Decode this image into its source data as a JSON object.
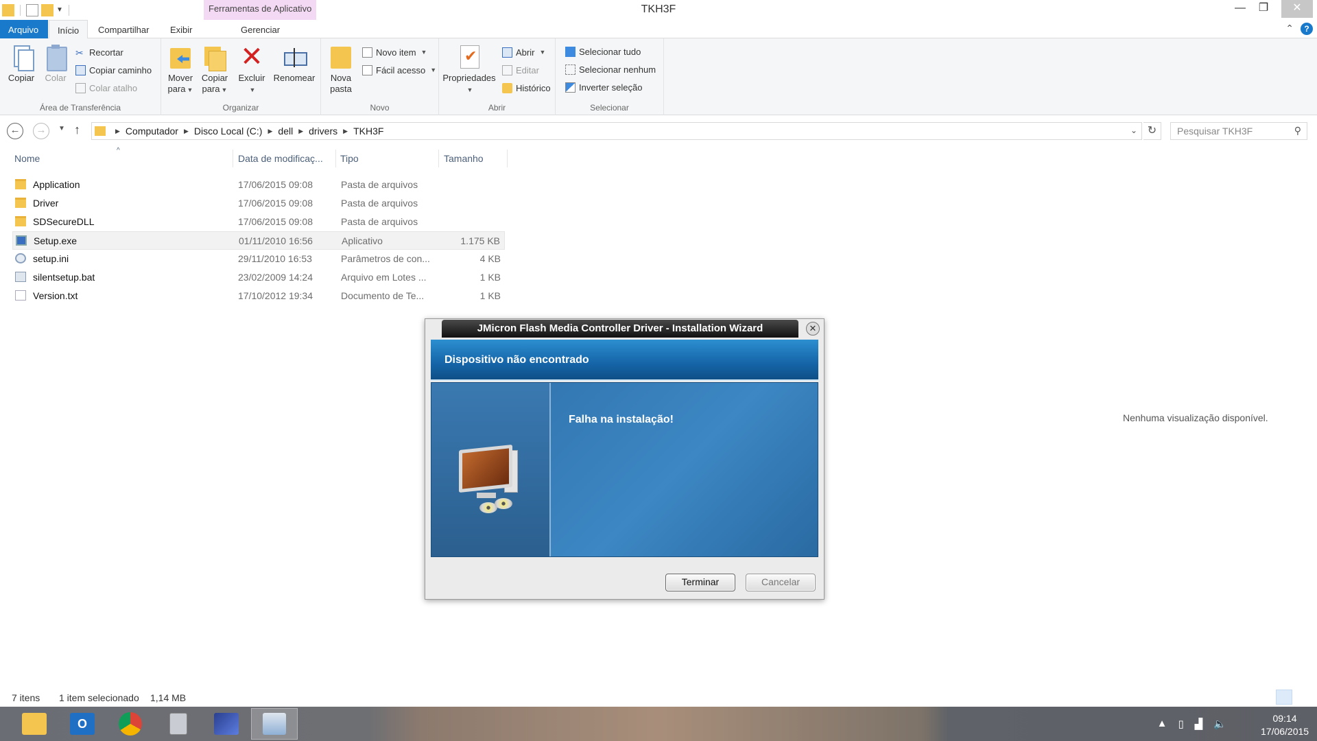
{
  "window": {
    "title": "TKH3F",
    "context_tab_header": "Ferramentas de Aplicativo",
    "controls": {
      "minimize": "—",
      "maximize": "❐",
      "close": "✕"
    }
  },
  "ribbon_tabs": [
    {
      "label": "Arquivo"
    },
    {
      "label": "Início"
    },
    {
      "label": "Compartilhar"
    },
    {
      "label": "Exibir"
    },
    {
      "label": "Gerenciar"
    }
  ],
  "ribbon": {
    "clipboard": {
      "group_label": "Área de Transferência",
      "copy": "Copiar",
      "paste": "Colar",
      "cut": "Recortar",
      "copy_path": "Copiar caminho",
      "paste_shortcut": "Colar atalho"
    },
    "organize": {
      "group_label": "Organizar",
      "move_to_1": "Mover",
      "move_to_2": "para",
      "copy_to_1": "Copiar",
      "copy_to_2": "para",
      "delete": "Excluir",
      "rename": "Renomear"
    },
    "new": {
      "group_label": "Novo",
      "new_folder_1": "Nova",
      "new_folder_2": "pasta",
      "new_item": "Novo item",
      "easy_access": "Fácil acesso"
    },
    "open": {
      "group_label": "Abrir",
      "properties": "Propriedades",
      "open": "Abrir",
      "edit": "Editar",
      "history": "Histórico"
    },
    "select": {
      "group_label": "Selecionar",
      "select_all": "Selecionar tudo",
      "select_none": "Selecionar nenhum",
      "invert": "Inverter seleção"
    }
  },
  "address": {
    "crumbs": [
      "Computador",
      "Disco Local (C:)",
      "dell",
      "drivers",
      "TKH3F"
    ],
    "search_placeholder": "Pesquisar TKH3F"
  },
  "columns": {
    "name": "Nome",
    "date": "Data de modificaç...",
    "type": "Tipo",
    "size": "Tamanho"
  },
  "files": [
    {
      "name": "Application",
      "date": "17/06/2015 09:08",
      "type": "Pasta de arquivos",
      "size": "",
      "icon": "folder-icon"
    },
    {
      "name": "Driver",
      "date": "17/06/2015 09:08",
      "type": "Pasta de arquivos",
      "size": "",
      "icon": "folder-icon"
    },
    {
      "name": "SDSecureDLL",
      "date": "17/06/2015 09:08",
      "type": "Pasta de arquivos",
      "size": "",
      "icon": "folder-icon"
    },
    {
      "name": "Setup.exe",
      "date": "01/11/2010 16:56",
      "type": "Aplicativo",
      "size": "1.175 KB",
      "icon": "exe-icon",
      "selected": true
    },
    {
      "name": "setup.ini",
      "date": "29/11/2010 16:53",
      "type": "Parâmetros de con...",
      "size": "4 KB",
      "icon": "ini-icon"
    },
    {
      "name": "silentsetup.bat",
      "date": "23/02/2009 14:24",
      "type": "Arquivo em Lotes ...",
      "size": "1 KB",
      "icon": "bat-icon"
    },
    {
      "name": "Version.txt",
      "date": "17/10/2012 19:34",
      "type": "Documento de Te...",
      "size": "1 KB",
      "icon": "txt-icon"
    }
  ],
  "preview": {
    "message": "Nenhuma visualização disponível."
  },
  "status": {
    "count": "7 itens",
    "selection": "1 item selecionado",
    "selection_size": "1,14 MB"
  },
  "dialog": {
    "title": "JMicron Flash Media Controller Driver - Installation Wizard",
    "header": "Dispositivo não encontrado",
    "message": "Falha na instalação!",
    "finish_button": "Terminar",
    "cancel_button": "Cancelar"
  },
  "taskbar": {
    "apps": [
      "file-explorer-icon",
      "outlook-icon",
      "chrome-icon",
      "calculator-icon",
      "app-icon",
      "installer-icon"
    ],
    "outlook_glyph": "O",
    "time": "09:14",
    "date": "17/06/2015"
  }
}
